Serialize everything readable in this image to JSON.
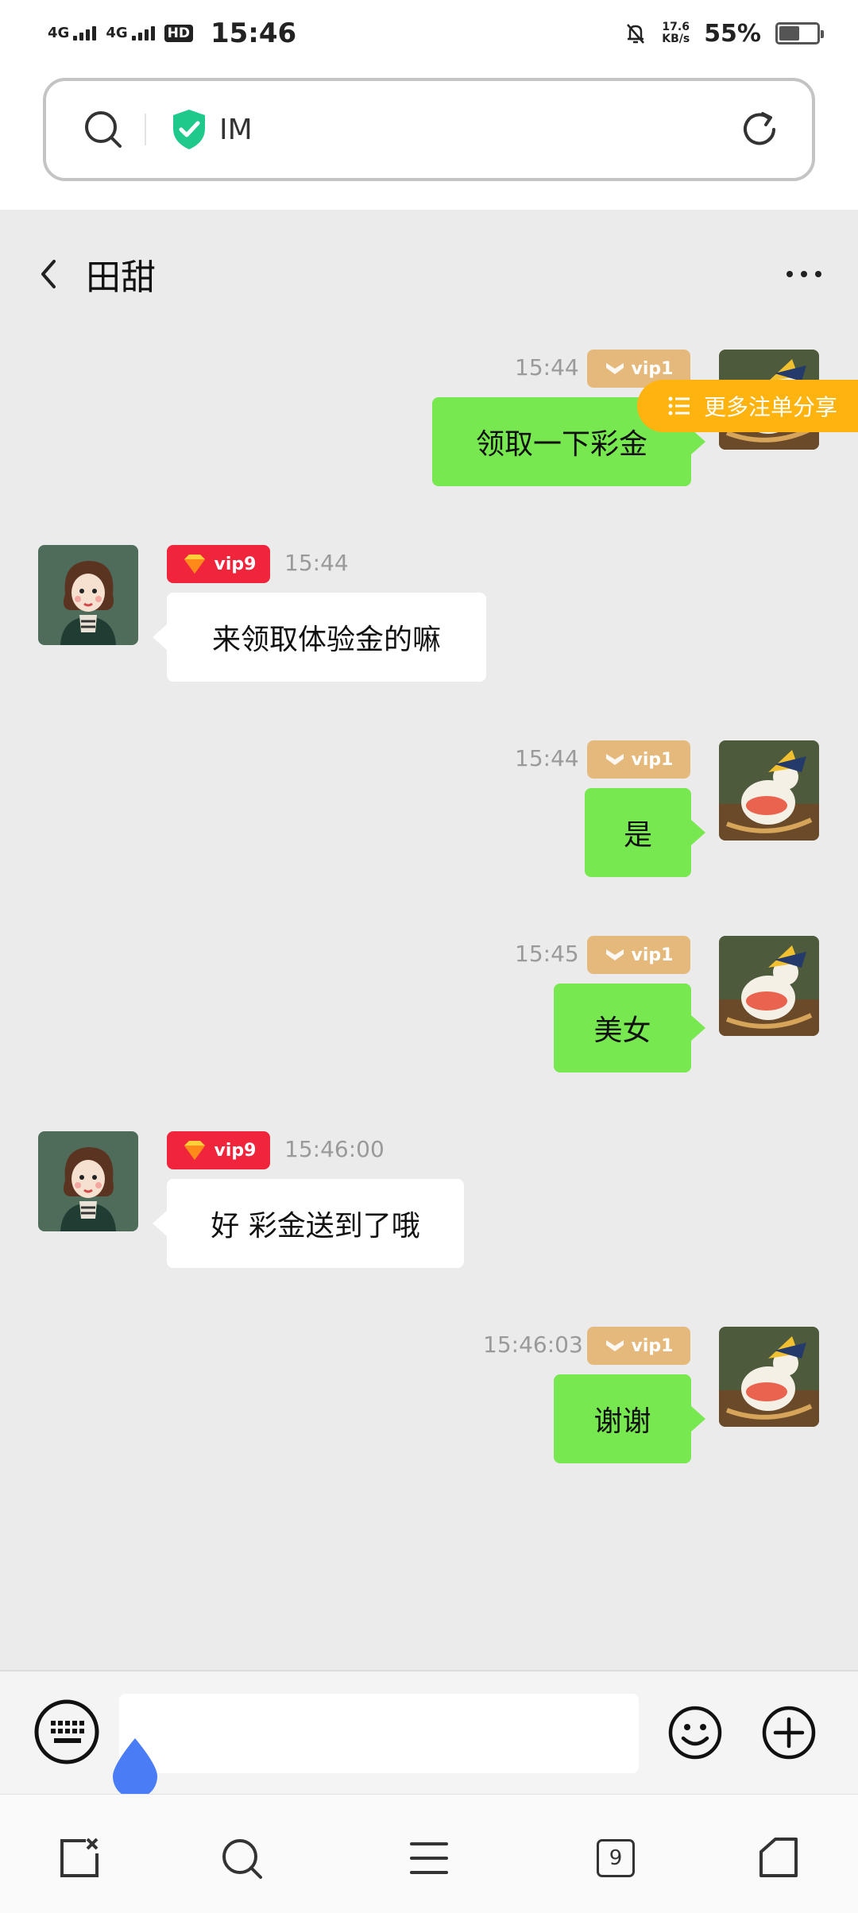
{
  "status_bar": {
    "network1": "4G",
    "network2": "4G",
    "hd": "HD",
    "time": "15:46",
    "net_speed_value": "17.6",
    "net_speed_unit": "KB/s",
    "battery_percent": "55%",
    "battery_level": 0.55
  },
  "browser": {
    "address_text": "IM",
    "tab_count": "9"
  },
  "chat": {
    "title": "田甜",
    "messages": [
      {
        "side": "out",
        "time": "15:44",
        "vip": "vip1",
        "text": "领取一下彩金"
      },
      {
        "side": "in",
        "time": "15:44",
        "vip": "vip9",
        "text": "来领取体验金的嘛"
      },
      {
        "side": "out",
        "time": "15:44",
        "vip": "vip1",
        "text": "是"
      },
      {
        "side": "out",
        "time": "15:45",
        "vip": "vip1",
        "text": "美女"
      },
      {
        "side": "in",
        "time": "15:46:00",
        "vip": "vip9",
        "text": "好 彩金送到了哦"
      },
      {
        "side": "out",
        "time": "15:46:03",
        "vip": "vip1",
        "text": "谢谢"
      }
    ]
  },
  "share_button": {
    "label": "更多注单分享"
  },
  "colors": {
    "out_bubble": "#77e850",
    "in_bubble": "#ffffff",
    "vip_gold": "#e5b97c",
    "vip_red": "#f0243a",
    "share_orange": "#ffb30f",
    "shield_green": "#1ec98b"
  },
  "icons": {
    "search": "search-icon",
    "shield": "shield-check-icon",
    "refresh": "refresh-icon",
    "back": "back-arrow-icon",
    "more": "more-dots-icon",
    "keyboard": "keyboard-icon",
    "emoji": "emoji-icon",
    "plus": "plus-icon",
    "close_page": "close-page-icon",
    "menu": "menu-icon",
    "home": "home-icon"
  }
}
